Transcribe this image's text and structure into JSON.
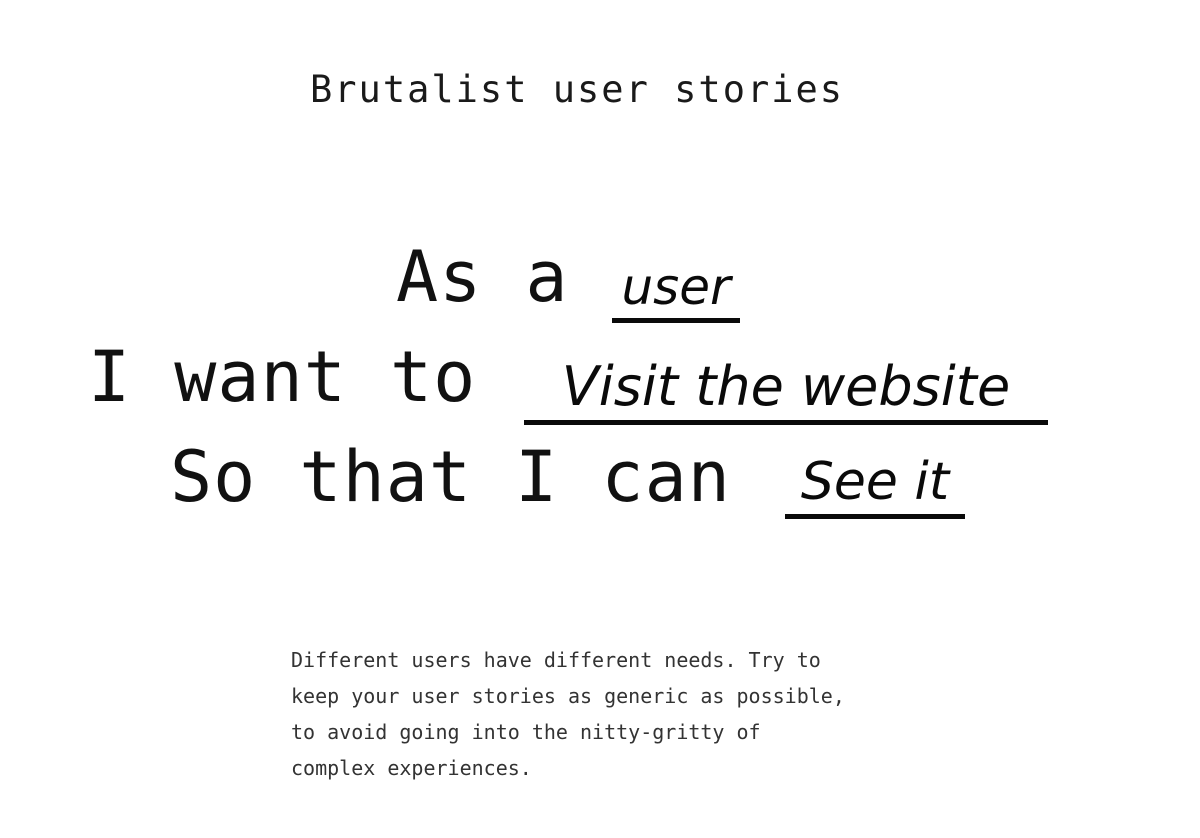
{
  "page": {
    "title": "Brutalist user stories"
  },
  "story": {
    "line1_prefix": "As a",
    "line1_blank": "user",
    "line2_prefix": "I want to",
    "line2_blank": "Visit the website",
    "line3_prefix": "So that I can",
    "line3_blank": "See it"
  },
  "description": {
    "text": "Different users have different needs. Try to keep your user stories as generic as possible, to avoid going into the nitty-gritty of complex experiences."
  }
}
